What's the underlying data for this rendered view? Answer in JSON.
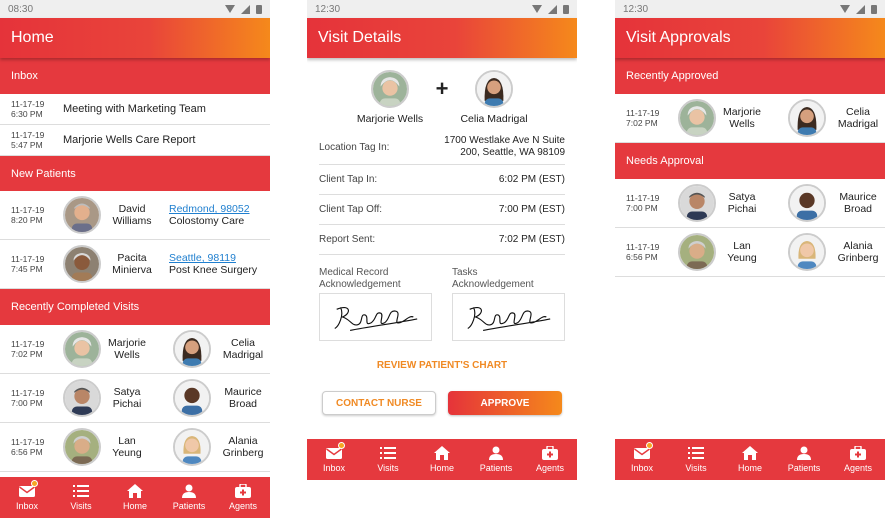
{
  "screens": {
    "home": {
      "status_time": "08:30",
      "title": "Home",
      "inbox_header": "Inbox",
      "messages": [
        {
          "date": "11-17-19",
          "time": "6:30 PM",
          "text": "Meeting with Marketing Team"
        },
        {
          "date": "11-17-19",
          "time": "5:47 PM",
          "text": "Marjorie Wells Care Report"
        }
      ],
      "new_patients_header": "New Patients",
      "new_patients": [
        {
          "date": "11-17-19",
          "time": "8:20 PM",
          "first": "David",
          "last": "Williams",
          "location": "Redmond, 98052",
          "desc": "Colostomy Care"
        },
        {
          "date": "11-17-19",
          "time": "7:45 PM",
          "first": "Pacita",
          "last": "Minierva",
          "location": "Seattle, 98119",
          "desc": "Post Knee Surgery"
        }
      ],
      "recent_visits_header": "Recently Completed Visits",
      "recent_visits": [
        {
          "date": "11-17-19",
          "time": "7:02 PM",
          "patient_first": "Marjorie",
          "patient_last": "Wells",
          "agent_first": "Celia",
          "agent_last": "Madrigal"
        },
        {
          "date": "11-17-19",
          "time": "7:00 PM",
          "patient_first": "Satya",
          "patient_last": "Pichai",
          "agent_first": "Maurice",
          "agent_last": "Broad"
        },
        {
          "date": "11-17-19",
          "time": "6:56 PM",
          "patient_first": "Lan",
          "patient_last": "Yeung",
          "agent_first": "Alania",
          "agent_last": "Grinberg"
        }
      ]
    },
    "details": {
      "status_time": "12:30",
      "title": "Visit Details",
      "patient": "Marjorie Wells",
      "plus": "+",
      "agent": "Celia Madrigal",
      "rows": [
        {
          "label": "Location Tag In:",
          "value1": "1700 Westlake Ave N Suite",
          "value2": "200, Seattle, WA 98109"
        },
        {
          "label": "Client Tap In:",
          "value1": "6:02 PM (EST)",
          "value2": ""
        },
        {
          "label": "Client Tap Off:",
          "value1": "7:00 PM (EST)",
          "value2": ""
        },
        {
          "label": "Report Sent:",
          "value1": "7:02 PM (EST)",
          "value2": ""
        }
      ],
      "ack1_line1": "Medical Record",
      "ack1_line2": "Acknowledgement",
      "ack2_line1": "Tasks",
      "ack2_line2": "Acknowledgement",
      "review_link": "REVIEW PATIENT'S CHART",
      "contact_button": "CONTACT NURSE",
      "approve_button": "APPROVE"
    },
    "approvals": {
      "status_time": "12:30",
      "title": "Visit Approvals",
      "recent_header": "Recently Approved",
      "recent": [
        {
          "date": "11-17-19",
          "time": "7:02 PM",
          "patient_first": "Marjorie",
          "patient_last": "Wells",
          "agent_first": "Celia",
          "agent_last": "Madrigal"
        }
      ],
      "needs_header": "Needs Approval",
      "needs": [
        {
          "date": "11-17-19",
          "time": "7:00 PM",
          "patient_first": "Satya",
          "patient_last": "Pichai",
          "agent_first": "Maurice",
          "agent_last": "Broad"
        },
        {
          "date": "11-17-19",
          "time": "6:56 PM",
          "patient_first": "Lan",
          "patient_last": "Yeung",
          "agent_first": "Alania",
          "agent_last": "Grinberg"
        }
      ]
    }
  },
  "tabs": {
    "inbox": "Inbox",
    "visits": "Visits",
    "home": "Home",
    "patients": "Patients",
    "agents": "Agents"
  },
  "icons": [
    "mail-icon",
    "list-icon",
    "home-icon",
    "person-icon",
    "medical-bag-icon"
  ],
  "colors": {
    "primary_red": "#e5393e",
    "accent_orange": "#f5891b",
    "link_blue": "#1f7fcf"
  }
}
